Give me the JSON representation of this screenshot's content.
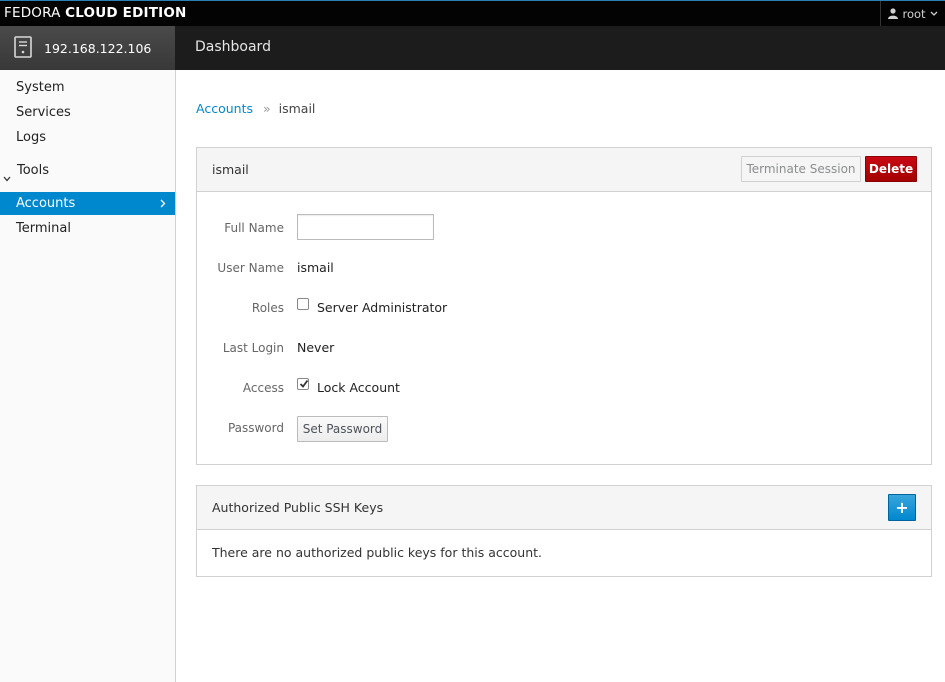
{
  "topbar": {
    "brand_light": "FEDORA",
    "brand_bold": "CLOUD EDITION",
    "user_label": "root",
    "user_icon": "user-icon"
  },
  "hostbar": {
    "host_name": "192.168.122.106",
    "host_icon": "server-icon",
    "page_title": "Dashboard"
  },
  "sidebar": {
    "items": [
      {
        "label": "System"
      },
      {
        "label": "Services"
      },
      {
        "label": "Logs"
      }
    ],
    "tools_label": "Tools",
    "tool_items": [
      {
        "label": "Accounts",
        "active": true
      },
      {
        "label": "Terminal",
        "active": false
      }
    ]
  },
  "breadcrumb": {
    "parent": "Accounts",
    "separator": "»",
    "current": "ismail"
  },
  "account_panel": {
    "title": "ismail",
    "terminate_label": "Terminate Session",
    "delete_label": "Delete",
    "fields": {
      "full_name_label": "Full Name",
      "full_name_value": "",
      "user_name_label": "User Name",
      "user_name_value": "ismail",
      "roles_label": "Roles",
      "roles_option": "Server Administrator",
      "roles_checked": false,
      "last_login_label": "Last Login",
      "last_login_value": "Never",
      "access_label": "Access",
      "access_option": "Lock Account",
      "access_checked": true,
      "password_label": "Password",
      "set_password_label": "Set Password"
    }
  },
  "ssh_panel": {
    "title": "Authorized Public SSH Keys",
    "add_label": "+",
    "empty_message": "There are no authorized public keys for this account."
  },
  "colors": {
    "accent": "#0088ce",
    "danger": "#c90813",
    "topbar": "#030303"
  }
}
